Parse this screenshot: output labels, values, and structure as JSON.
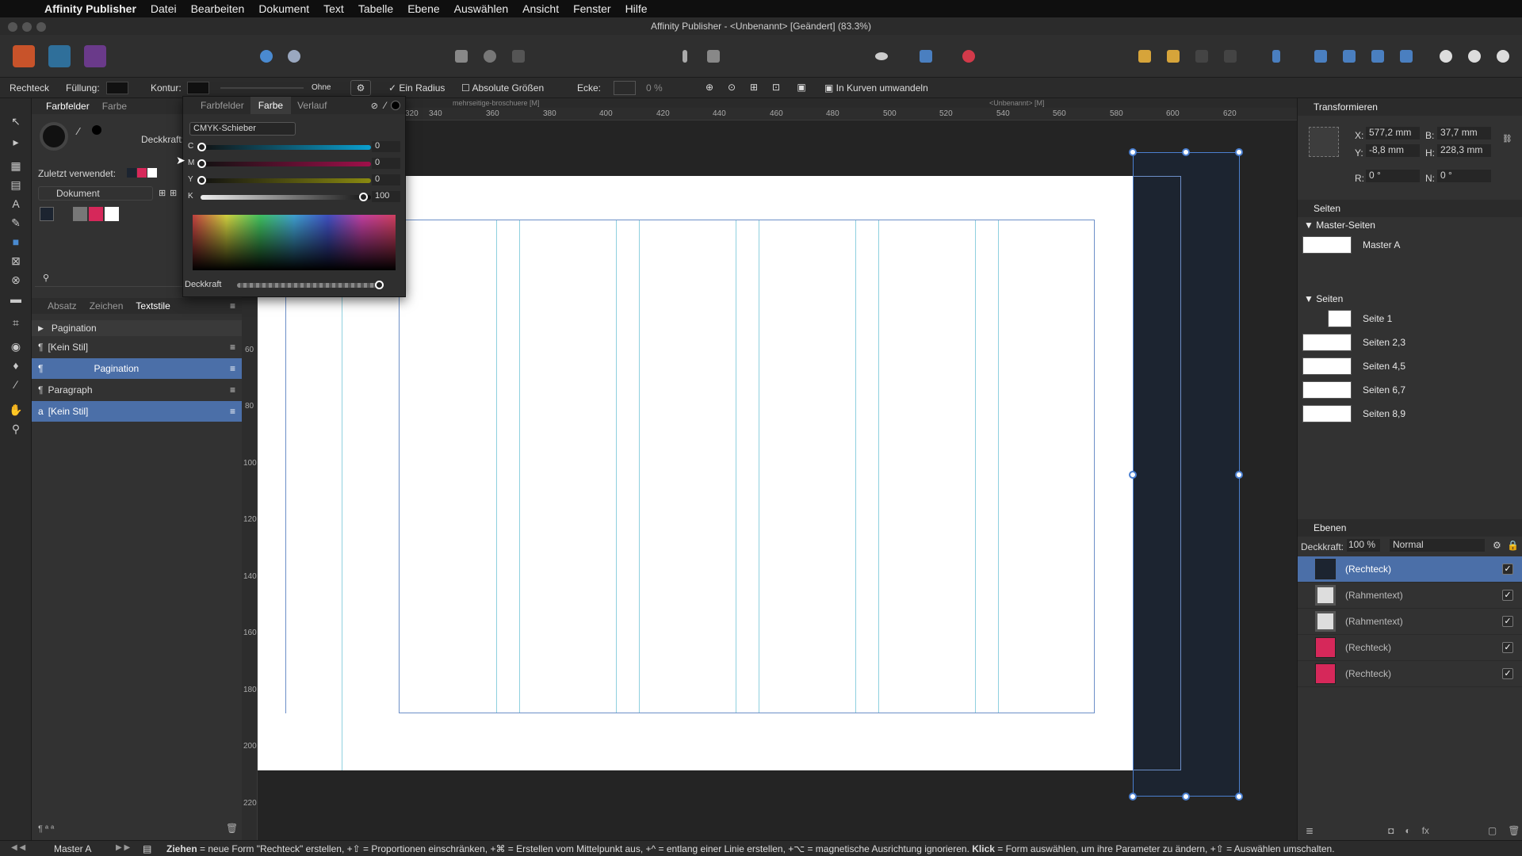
{
  "menubar": {
    "app_name": "Affinity Publisher",
    "items": [
      "Datei",
      "Bearbeiten",
      "Dokument",
      "Text",
      "Tabelle",
      "Ebene",
      "Auswählen",
      "Ansicht",
      "Fenster",
      "Hilfe"
    ]
  },
  "window": {
    "title": "Affinity Publisher - <Unbenannt> [Geändert] (83.3%)"
  },
  "context_toolbar": {
    "tool_name": "Rechteck",
    "fill_label": "Füllung:",
    "stroke_label": "Kontur:",
    "stroke_value": "Ohne",
    "one_radius": "Ein Radius",
    "absolute_sizes": "Absolute Größen",
    "corner_label": "Ecke:",
    "corner_percent": "0 %",
    "convert_curves": "In Kurven umwandeln"
  },
  "left_panel": {
    "tabs": [
      "Farbfelder",
      "Farbe"
    ],
    "opacity_label": "Deckkraft:",
    "recent_label": "Zuletzt verwendet:",
    "palette": "Dokument",
    "style_tabs": [
      "Absatz",
      "Zeichen",
      "Textstile"
    ],
    "styles": [
      {
        "label": "Pagination",
        "kind": "group"
      },
      {
        "label": "[Kein Stil]",
        "kind": "para"
      },
      {
        "label": "Pagination",
        "kind": "para",
        "selected": true
      },
      {
        "label": "Paragraph",
        "kind": "para"
      },
      {
        "label": "[Kein Stil]",
        "kind": "char",
        "selected": true
      }
    ]
  },
  "color_popup": {
    "tabs": [
      "Farbfelder",
      "Farbe",
      "Verlauf"
    ],
    "mode": "CMYK-Schieber",
    "channels": [
      {
        "name": "C",
        "value": "0"
      },
      {
        "name": "M",
        "value": "0"
      },
      {
        "name": "Y",
        "value": "0"
      },
      {
        "name": "K",
        "value": "100"
      }
    ],
    "opacity_label": "Deckkraft"
  },
  "document_tabs": [
    "mehrseitige-broschuere [M]",
    "<Unbenannt> [M]"
  ],
  "ruler_h": [
    "320",
    "340",
    "360",
    "380",
    "400",
    "420",
    "440",
    "460",
    "480",
    "500",
    "520",
    "540",
    "560",
    "580",
    "600",
    "620"
  ],
  "ruler_v": [
    "60",
    "80",
    "100",
    "120",
    "140",
    "160",
    "180",
    "200",
    "220"
  ],
  "transform": {
    "title": "Transformieren",
    "x_label": "X:",
    "x": "577,2 mm",
    "y_label": "Y:",
    "y": "-8,8 mm",
    "w_label": "B:",
    "w": "37,7 mm",
    "h_label": "H:",
    "h": "228,3 mm",
    "r_label": "R:",
    "r": "0 °",
    "s_label": "N:",
    "s": "0 °"
  },
  "pages_panel": {
    "title": "Seiten",
    "master_heading": "Master-Seiten",
    "masters": [
      "Master A"
    ],
    "pages_heading": "Seiten",
    "pages": [
      "Seite 1",
      "Seiten 2,3",
      "Seiten 4,5",
      "Seiten 6,7",
      "Seiten 8,9"
    ]
  },
  "layers_panel": {
    "title": "Ebenen",
    "opacity_label": "Deckkraft:",
    "opacity": "100 %",
    "blend": "Normal",
    "layers": [
      {
        "label": "(Rechteck)",
        "thumb": "#1c2430",
        "selected": true
      },
      {
        "label": "(Rahmentext)",
        "thumb": "frame"
      },
      {
        "label": "(Rahmentext)",
        "thumb": "frame"
      },
      {
        "label": "(Rechteck)",
        "thumb": "#d6285a"
      },
      {
        "label": "(Rechteck)",
        "thumb": "#d6285a"
      }
    ]
  },
  "statusbar": {
    "master": "Master A",
    "hint_bold1": "Ziehen",
    "hint1": " = neue Form \"Rechteck\" erstellen, +⇧ = Proportionen einschränken, +⌘ = Erstellen vom Mittelpunkt aus, +^ = entlang einer Linie erstellen, +⌥ = magnetische Ausrichtung ignorieren. ",
    "hint_bold2": "Klick",
    "hint2": " = Form auswählen, um ihre Parameter zu ändern, +⇧ = Auswählen umschalten."
  },
  "colors": {
    "accent": "#4b6fa8",
    "pink": "#d6285a",
    "dark_rect": "#1c2430"
  }
}
